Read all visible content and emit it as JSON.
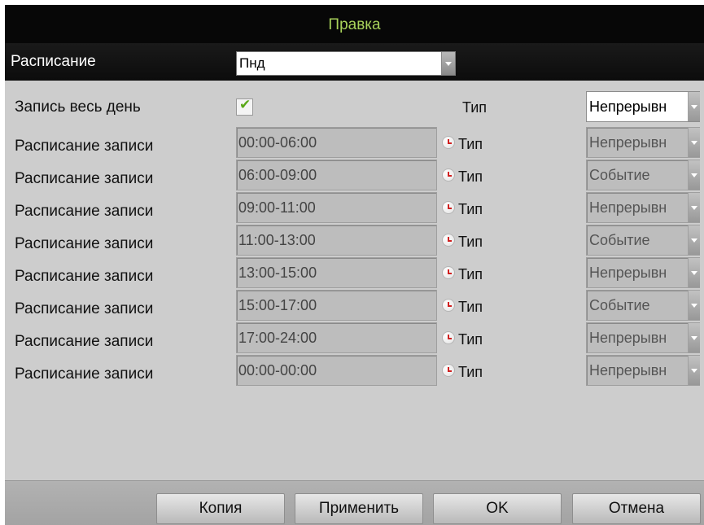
{
  "window": {
    "title": "Правка"
  },
  "schedule": {
    "label": "Расписание",
    "selected_day": "Пнд"
  },
  "all_day": {
    "label": "Запись весь день",
    "checked": true,
    "type_label": "Тип",
    "type_value": "Непрерывн"
  },
  "rows": [
    {
      "label": "Расписание записи",
      "time": "00:00-06:00",
      "type_label": "Тип",
      "type": "Непрерывн"
    },
    {
      "label": "Расписание записи",
      "time": "06:00-09:00",
      "type_label": "Тип",
      "type": "Событие"
    },
    {
      "label": "Расписание записи",
      "time": "09:00-11:00",
      "type_label": "Тип",
      "type": "Непрерывн"
    },
    {
      "label": "Расписание записи",
      "time": "11:00-13:00",
      "type_label": "Тип",
      "type": "Событие"
    },
    {
      "label": "Расписание записи",
      "time": "13:00-15:00",
      "type_label": "Тип",
      "type": "Непрерывн"
    },
    {
      "label": "Расписание записи",
      "time": "15:00-17:00",
      "type_label": "Тип",
      "type": "Событие"
    },
    {
      "label": "Расписание записи",
      "time": "17:00-24:00",
      "type_label": "Тип",
      "type": "Непрерывн"
    },
    {
      "label": "Расписание записи",
      "time": "00:00-00:00",
      "type_label": "Тип",
      "type": "Непрерывн"
    }
  ],
  "buttons": {
    "copy": "Копия",
    "apply": "Применить",
    "ok": "OK",
    "cancel": "Отмена"
  },
  "icons": {
    "dropdown": "chevron-down-icon",
    "checkbox": "check-icon",
    "clock": "clock-icon"
  },
  "colors": {
    "title_text": "#a8d25a",
    "header_bg": "#070707",
    "panel_bg": "#cdcdcd",
    "check": "#5aa818",
    "clock_hand": "#d02020"
  }
}
